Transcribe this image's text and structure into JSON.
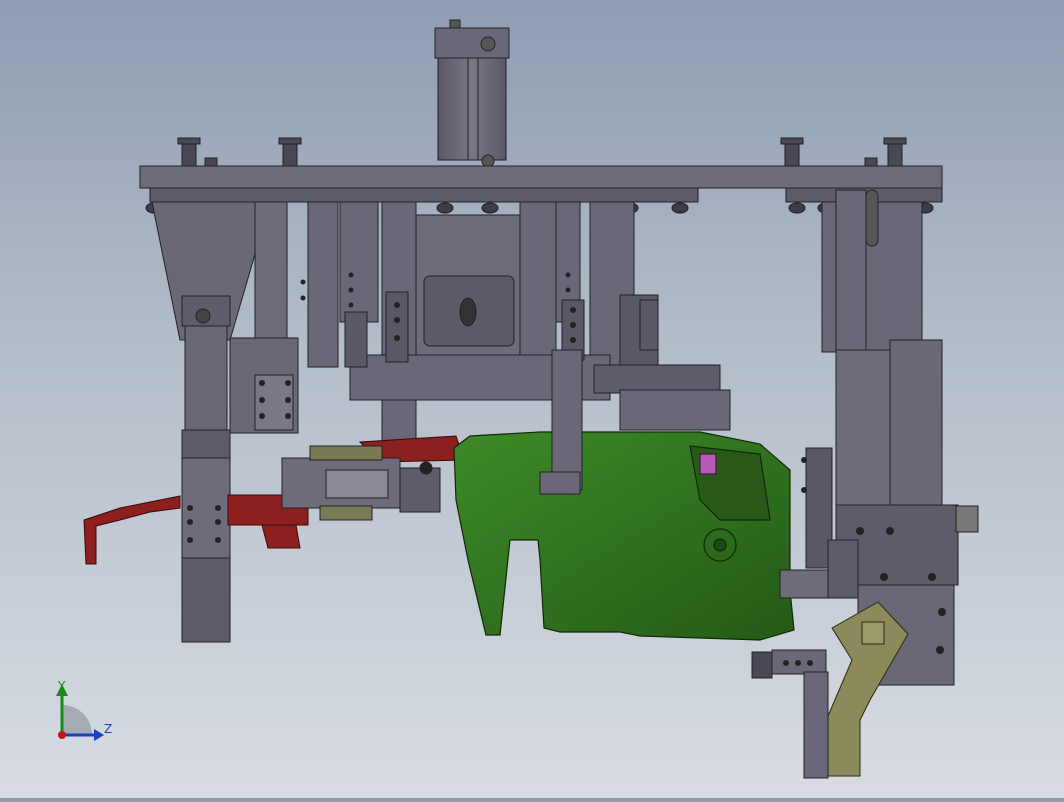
{
  "viewport": {
    "background_top": "#8e9db3",
    "background_bottom": "#d7dce2"
  },
  "model": {
    "colors": {
      "steel": "#6e6c7a",
      "steel_dark": "#4c4a57",
      "steel_light": "#8a8896",
      "green_part": "#2f6b1f",
      "red_part": "#8e1f1f",
      "olive_part": "#8a8a5a"
    }
  },
  "triad": {
    "y_label": "Y",
    "z_label": "Z",
    "y_color": "#1a8a1a",
    "z_color": "#1a3fbf",
    "x_color": "#c01818"
  }
}
